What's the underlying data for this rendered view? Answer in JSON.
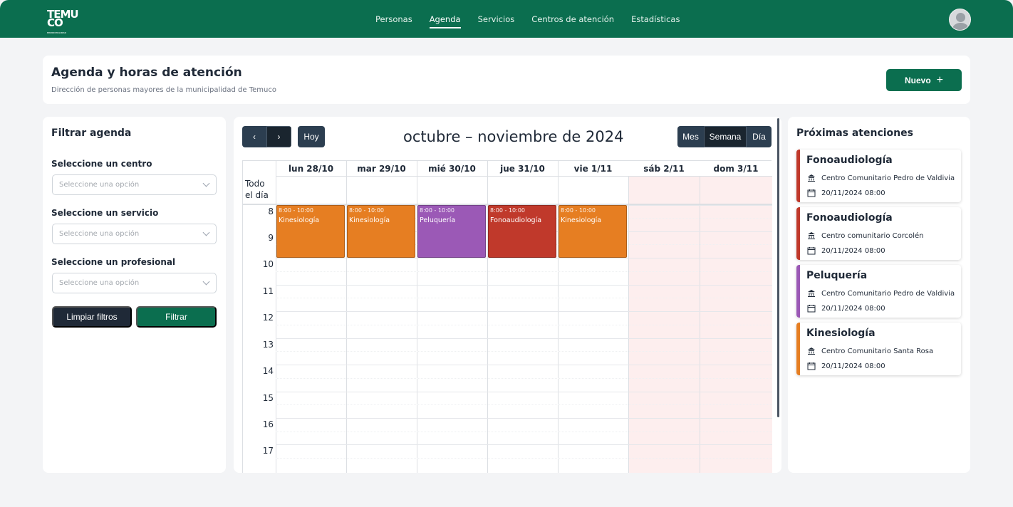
{
  "nav": {
    "logo": "TEMU CO",
    "logo_sub": "MUNICIPALIDAD",
    "items": [
      "Personas",
      "Agenda",
      "Servicios",
      "Centros de atención",
      "Estadísticas"
    ],
    "active": "Agenda"
  },
  "page": {
    "title": "Agenda y horas de atención",
    "subtitle": "Dirección de personas mayores de la municipalidad de Temuco",
    "new_button": "Nuevo",
    "new_button_icon": "plus-icon"
  },
  "filters": {
    "title": "Filtrar agenda",
    "centro_label": "Seleccione un centro",
    "centro_placeholder": "Seleccione una opción",
    "servicio_label": "Seleccione un servicio",
    "servicio_placeholder": "Seleccione una opción",
    "profesional_label": "Seleccione un profesional",
    "profesional_placeholder": "Seleccione una opción",
    "clear_button": "Limpiar filtros",
    "filter_button": "Filtrar"
  },
  "calendar": {
    "title": "octubre – noviembre de 2024",
    "prev_icon": "chevron-left-icon",
    "next_icon": "chevron-right-icon",
    "today_button": "Hoy",
    "views": [
      "Mes",
      "Semana",
      "Día"
    ],
    "active_view": "Semana",
    "all_day_label": [
      "Todo",
      "el día"
    ],
    "days": [
      "lun 28/10",
      "mar 29/10",
      "mié 30/10",
      "jue 31/10",
      "vie 1/11",
      "sáb 2/11",
      "dom 3/11"
    ],
    "hours": [
      "8",
      "9",
      "10",
      "11",
      "12",
      "13",
      "14",
      "15",
      "16",
      "17"
    ],
    "events": [
      {
        "day": "lun 28/10",
        "time": "8:00 - 10:00",
        "title": "Kinesiología",
        "color": "#e67e22"
      },
      {
        "day": "mar 29/10",
        "time": "8:00 - 10:00",
        "title": "Kinesiología",
        "color": "#e67e22"
      },
      {
        "day": "mié 30/10",
        "time": "8:00 - 10:00",
        "title": "Peluquería",
        "color": "#9b59b6"
      },
      {
        "day": "jue 31/10",
        "time": "8:00 - 10:00",
        "title": "Fonoaudiología",
        "color": "#c0392b"
      },
      {
        "day": "vie 1/11",
        "time": "8:00 - 10:00",
        "title": "Kinesiología",
        "color": "#e67e22"
      }
    ]
  },
  "upcoming": {
    "title": "Próximas atenciones",
    "items": [
      {
        "title": "Fonoaudiología",
        "center": "Centro Comunitario Pedro de Valdivia",
        "datetime": "20/11/2024 08:00",
        "color": "#c0392b"
      },
      {
        "title": "Fonoaudiología",
        "center": "Centro comunitario Corcolén",
        "datetime": "20/11/2024 08:00",
        "color": "#c0392b"
      },
      {
        "title": "Peluquería",
        "center": "Centro Comunitario Pedro de Valdivia",
        "datetime": "20/11/2024 08:00",
        "color": "#9b59b6"
      },
      {
        "title": "Kinesiología",
        "center": "Centro Comunitario Santa Rosa",
        "datetime": "20/11/2024 08:00",
        "color": "#e67e22"
      }
    ]
  }
}
